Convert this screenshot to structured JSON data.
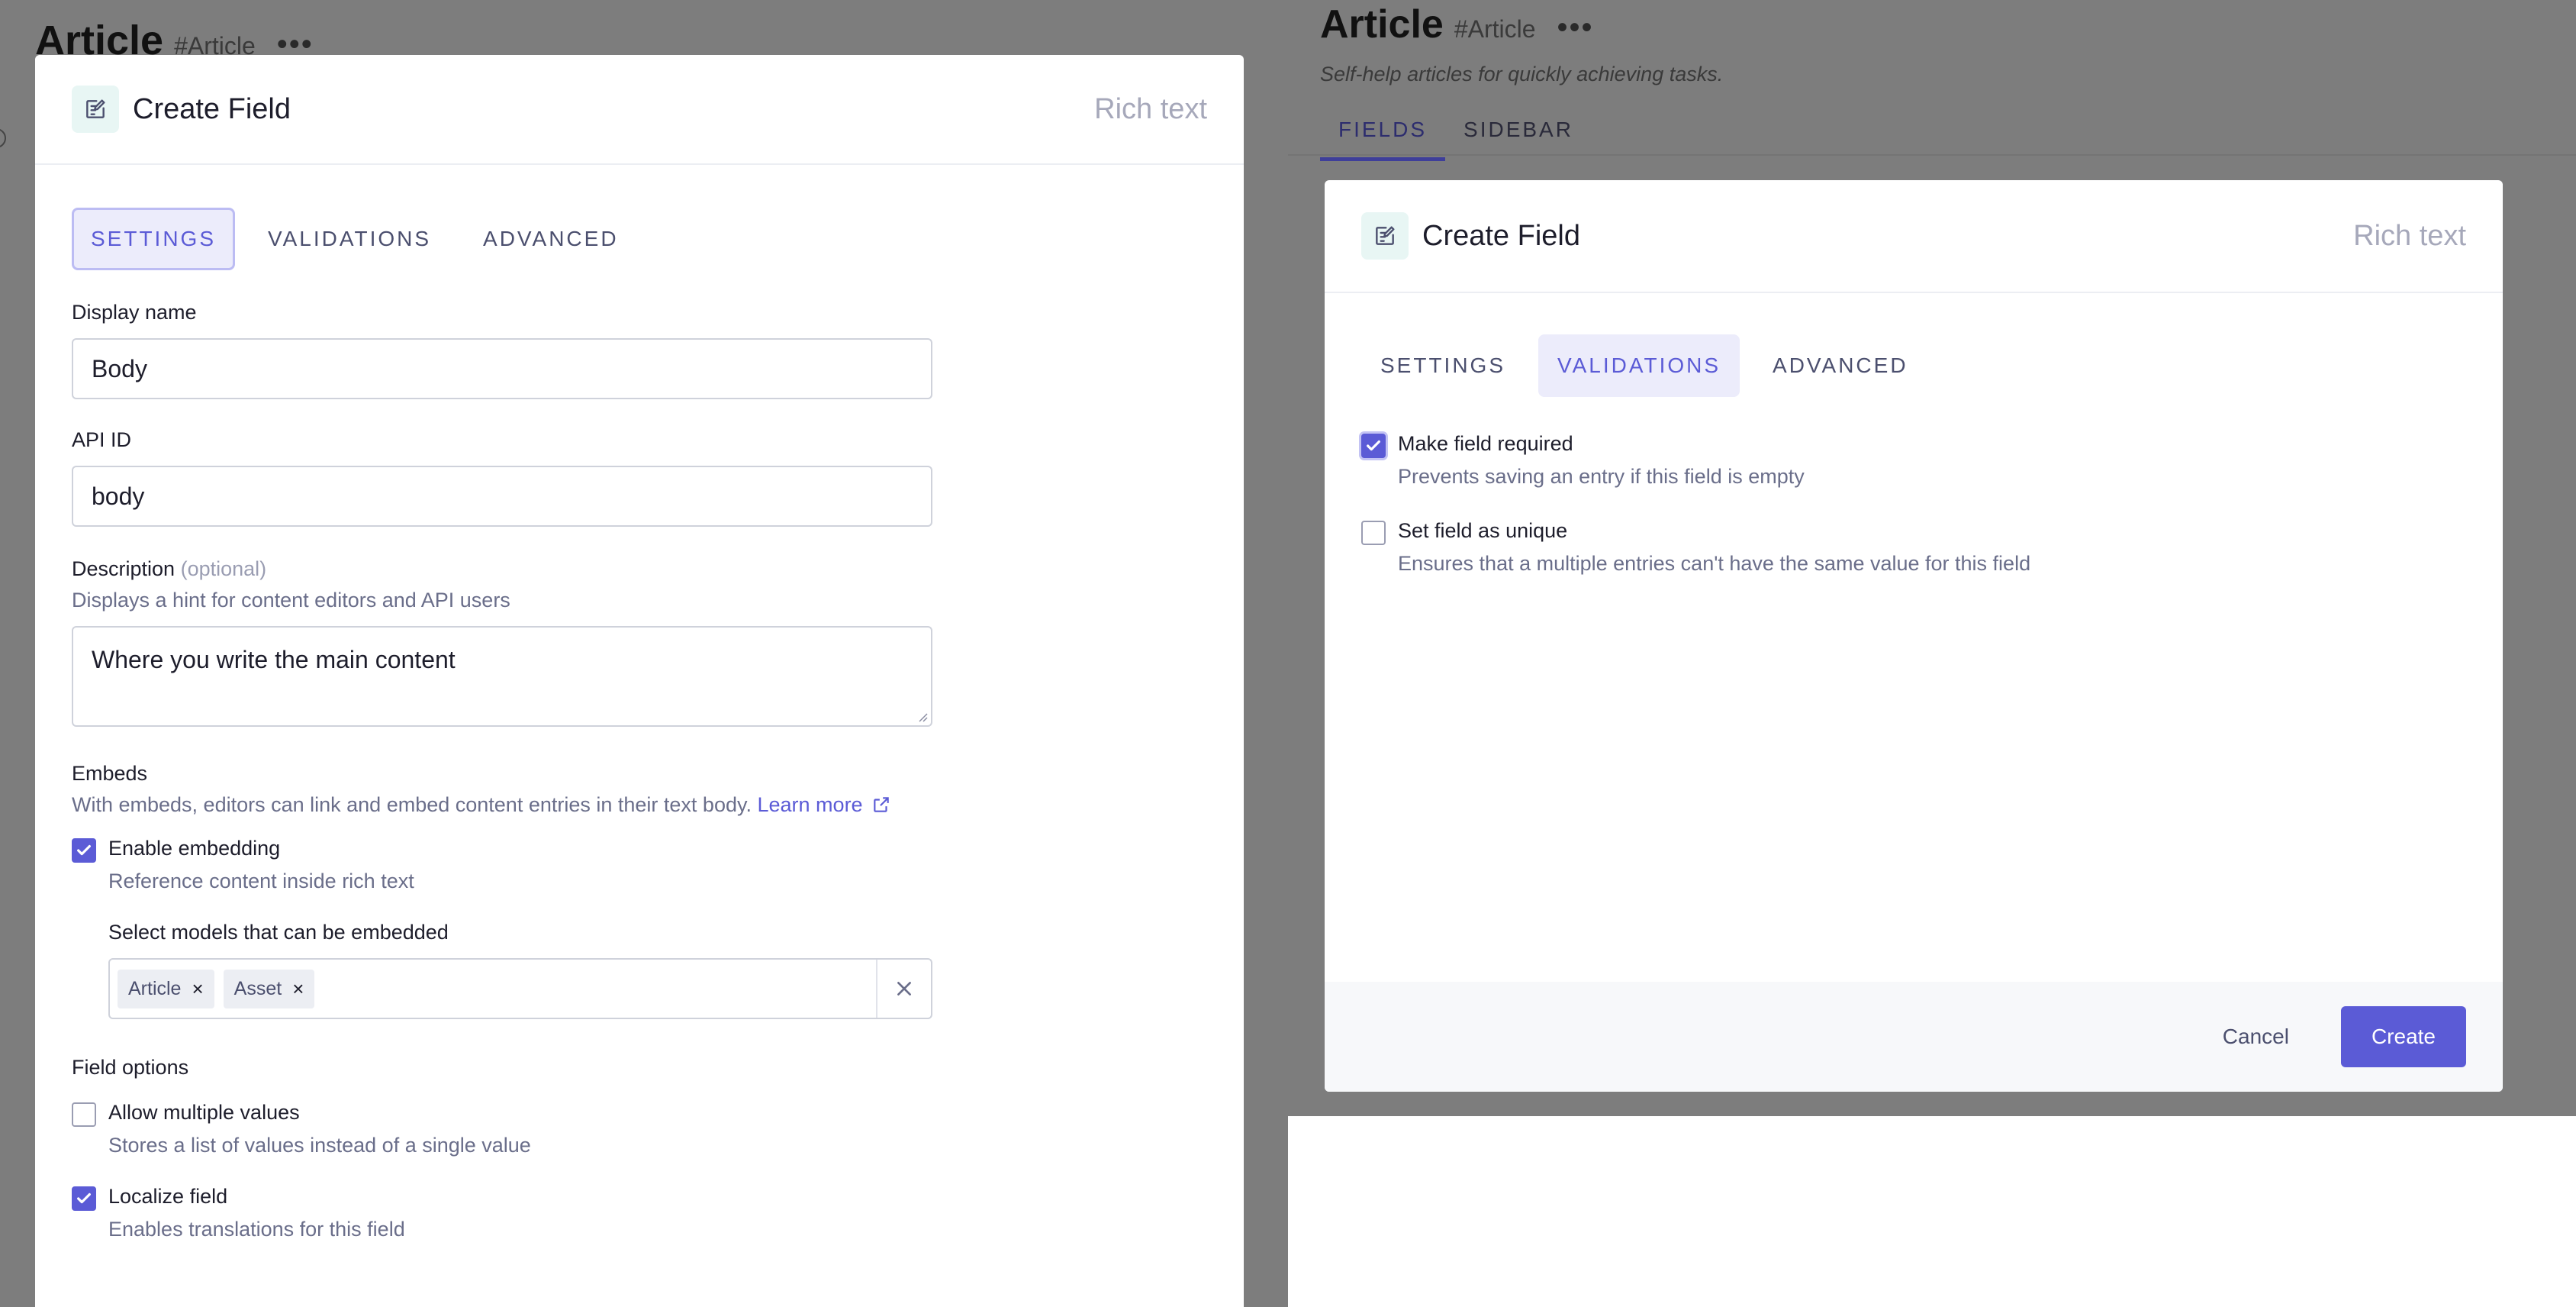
{
  "left": {
    "background": {
      "title": "Article",
      "hash": "#Article",
      "more": "•••"
    },
    "modal": {
      "title": "Create Field",
      "type": "Rich text",
      "tabs": [
        "SETTINGS",
        "VALIDATIONS",
        "ADVANCED"
      ],
      "active_tab": "SETTINGS",
      "display_name": {
        "label": "Display name",
        "value": "Body"
      },
      "api_id": {
        "label": "API ID",
        "value": "body"
      },
      "description": {
        "label": "Description",
        "optional": "(optional)",
        "hint": "Displays a hint for content editors and API users",
        "value": "Where you write the main content"
      },
      "embeds": {
        "label": "Embeds",
        "hint": "With embeds, editors can link and embed content entries in their text body.",
        "learn_more": "Learn more",
        "enable": {
          "title": "Enable embedding",
          "sub": "Reference content inside rich text",
          "checked": true
        },
        "select_label": "Select models that can be embedded",
        "tags": [
          "Article",
          "Asset"
        ],
        "tag_remove": "×"
      },
      "field_options": {
        "label": "Field options",
        "multiple": {
          "title": "Allow multiple values",
          "sub": "Stores a list of values instead of a single value",
          "checked": false
        },
        "localize": {
          "title": "Localize field",
          "sub": "Enables translations for this field",
          "checked": true
        }
      }
    }
  },
  "right": {
    "background": {
      "title": "Article",
      "hash": "#Article",
      "more": "•••",
      "description": "Self-help articles for quickly achieving tasks.",
      "tabs": [
        "FIELDS",
        "SIDEBAR"
      ],
      "active_tab": "FIELDS"
    },
    "modal": {
      "title": "Create Field",
      "type": "Rich text",
      "tabs": [
        "SETTINGS",
        "VALIDATIONS",
        "ADVANCED"
      ],
      "active_tab": "VALIDATIONS",
      "required": {
        "title": "Make field required",
        "sub": "Prevents saving an entry if this field is empty",
        "checked": true
      },
      "unique": {
        "title": "Set field as unique",
        "sub": "Ensures that a multiple entries can't have the same value for this field",
        "checked": false
      },
      "cancel": "Cancel",
      "create": "Create"
    }
  },
  "colors": {
    "accent": "#5b5bd6",
    "overlay": "#7d7d7d",
    "icon_bg": "#e8f6f4",
    "muted": "#6a6e8a"
  }
}
